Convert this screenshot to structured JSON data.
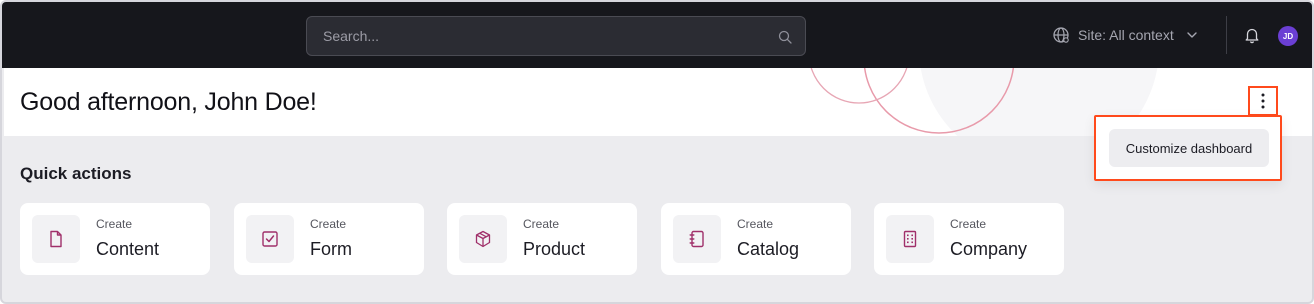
{
  "topbar": {
    "search_placeholder": "Search...",
    "site_label": "Site: All context",
    "avatar_initials": "JD",
    "avatar_color": "#6b3fd4"
  },
  "greeting": "Good afternoon, John Doe!",
  "menu": {
    "items": [
      "Customize dashboard"
    ]
  },
  "quick_actions": {
    "title": "Quick actions",
    "cards": [
      {
        "prefix": "Create",
        "label": "Content",
        "icon": "document-icon"
      },
      {
        "prefix": "Create",
        "label": "Form",
        "icon": "checkbox-icon"
      },
      {
        "prefix": "Create",
        "label": "Product",
        "icon": "box-icon"
      },
      {
        "prefix": "Create",
        "label": "Catalog",
        "icon": "notebook-icon"
      },
      {
        "prefix": "Create",
        "label": "Company",
        "icon": "building-icon"
      }
    ]
  },
  "colors": {
    "accent": "#a0306a",
    "highlight": "#ff4a1c",
    "topbar_bg": "#16171c"
  }
}
